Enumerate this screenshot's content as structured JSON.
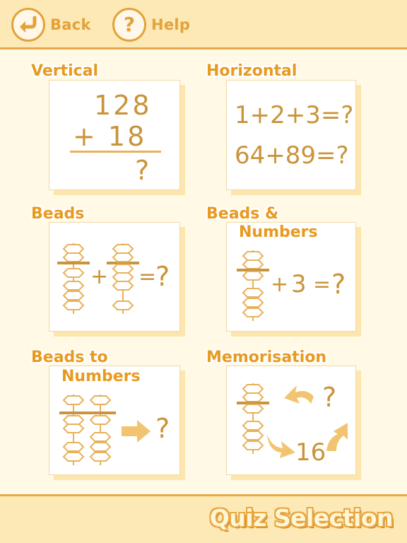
{
  "header": {
    "back_label": "Back",
    "help_label": "Help",
    "help_glyph": "?"
  },
  "tiles": [
    {
      "title": "Vertical",
      "top": "128",
      "bottom": "+ 18",
      "answer": "?"
    },
    {
      "title": "Horizontal",
      "line1": "1+2+3=?",
      "line2": "64+89=?"
    },
    {
      "title": "Beads",
      "plus": "+",
      "equals": "=",
      "answer": "?"
    },
    {
      "title_line1": "Beads &",
      "title_line2": "Numbers",
      "plus": "+",
      "number": "3",
      "equals": "=",
      "answer": "?"
    },
    {
      "title_line1": "Beads to",
      "title_line2": "Numbers",
      "answer": "?"
    },
    {
      "title": "Memorisation",
      "answer": "?",
      "number": "16"
    }
  ],
  "footer": {
    "title": "Quiz Selection"
  },
  "colors": {
    "accent": "#e89a1f",
    "bead": "#c9943b",
    "bar": "#fde9b5",
    "border": "#e7a84a"
  }
}
